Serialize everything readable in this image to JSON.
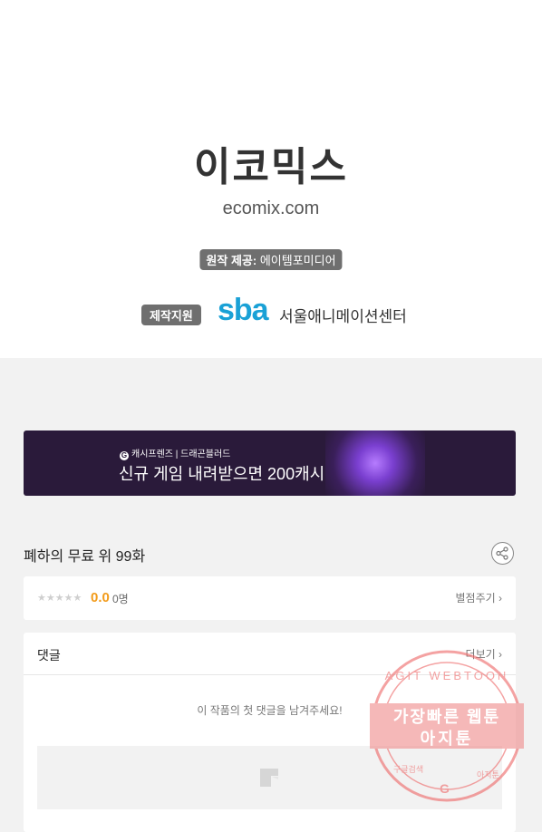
{
  "header": {
    "logo_text": "이코믹스",
    "domain": "ecomix.com",
    "provider_label": "원작 제공:",
    "provider_name": "에이템포미디어",
    "production_label": "제작지원",
    "sba_logo": "sba",
    "sba_name": "서울애니메이션센터"
  },
  "banner": {
    "brand_line": "캐시프렌즈 | 드래곤블러드",
    "brand_icon": "G",
    "headline": "신규 게임 내려받으면 200캐시"
  },
  "episode": {
    "title": "폐하의 무료 위 99화",
    "share_icon": "share-icon"
  },
  "rating": {
    "stars": "★★★★★",
    "score": "0.0",
    "count": "0명",
    "rate_link": "별점주기 ›"
  },
  "comments": {
    "label": "댓글",
    "more_link": "더보기 ›",
    "empty_message": "이 작품의 첫 댓글을 남겨주세요!"
  },
  "watermark": {
    "top_text": "AGIT WEBTOON",
    "line1": "가장빠른 웹툰",
    "line2": "아지툰",
    "small_left": "구글검색",
    "small_right": "아지툰",
    "g_letter": "G"
  },
  "colors": {
    "accent_orange": "#f29b1a",
    "sba_blue": "#1aa1d6",
    "banner_bg": "#2a1a3a",
    "watermark_red": "#f08a8a"
  }
}
